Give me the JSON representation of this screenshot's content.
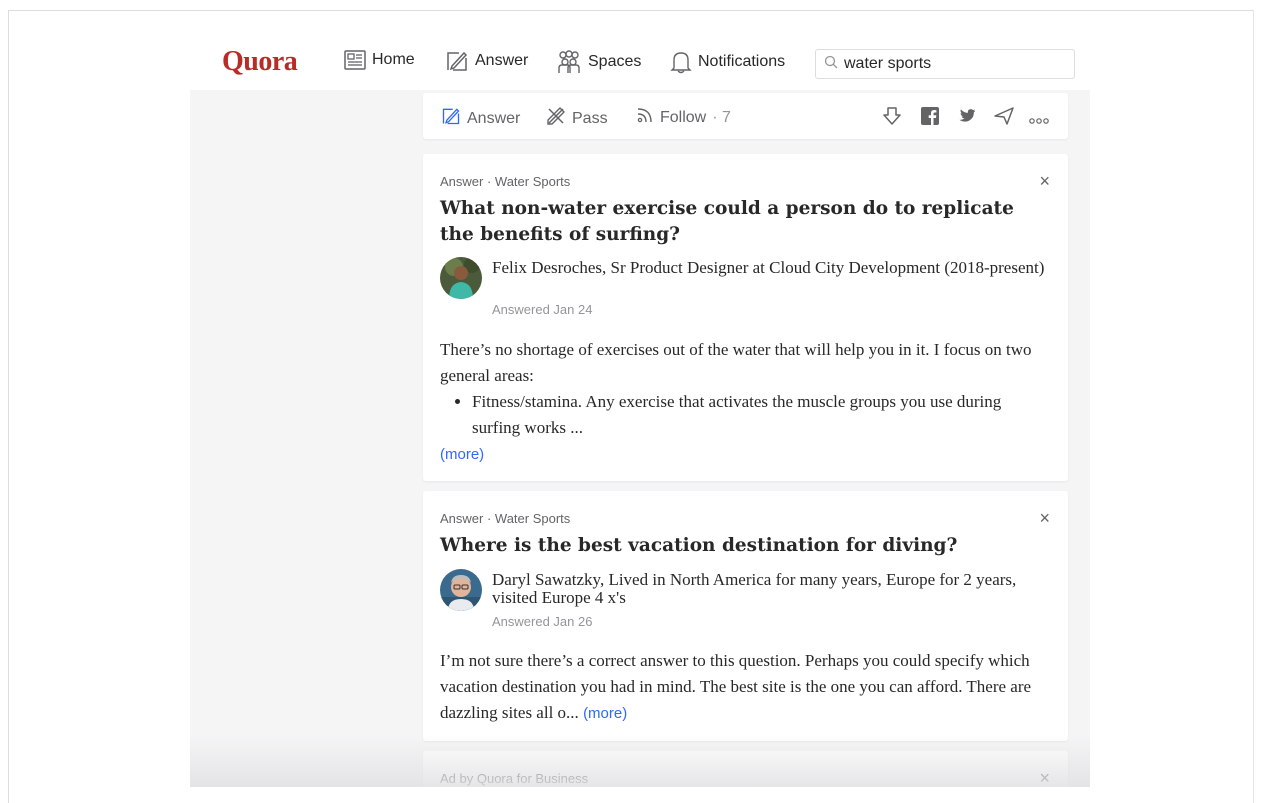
{
  "nav": {
    "logo": "Quora",
    "home": "Home",
    "answer": "Answer",
    "spaces": "Spaces",
    "notifications": "Notifications",
    "search_value": "water sports",
    "brand_color": "#b92b27"
  },
  "action_bar": {
    "answer": "Answer",
    "pass": "Pass",
    "follow": "Follow",
    "follow_count": "· 7",
    "icons": [
      "downvote-icon",
      "facebook-icon",
      "twitter-icon",
      "share-icon",
      "more-icon"
    ]
  },
  "cards": [
    {
      "meta": "Answer · Water Sports",
      "close": "×",
      "title": "What non-water exercise could a person do to replicate the benefits of surfing?",
      "author": "Felix Desroches, Sr Product Designer at Cloud City Development (2018-present)",
      "answered": "Answered Jan 24",
      "intro": "There’s no shortage of exercises out of the water that will help you in it. I focus on two general areas:",
      "bullet": "Fitness/stamina. Any exercise that activates the muscle groups you use during surfing works ...",
      "more": "(more)"
    },
    {
      "meta": "Answer · Water Sports",
      "close": "×",
      "title": "Where is the best vacation destination for diving?",
      "author": "Daryl Sawatzky, Lived in North America for many years, Europe for 2 years, visited Europe 4 x's",
      "answered": "Answered Jan 26",
      "body": "I’m not sure there’s a correct answer to this question. Perhaps you could specify which vacation destination you had in mind. The best site is the one you can afford. There are dazzling sites all o...",
      "more": "(more)"
    },
    {
      "meta": "Ad by Quora for Business",
      "close": "×"
    }
  ],
  "colors": {
    "link_blue": "#2e69ff",
    "feed_bg": "#f5f5f6"
  }
}
